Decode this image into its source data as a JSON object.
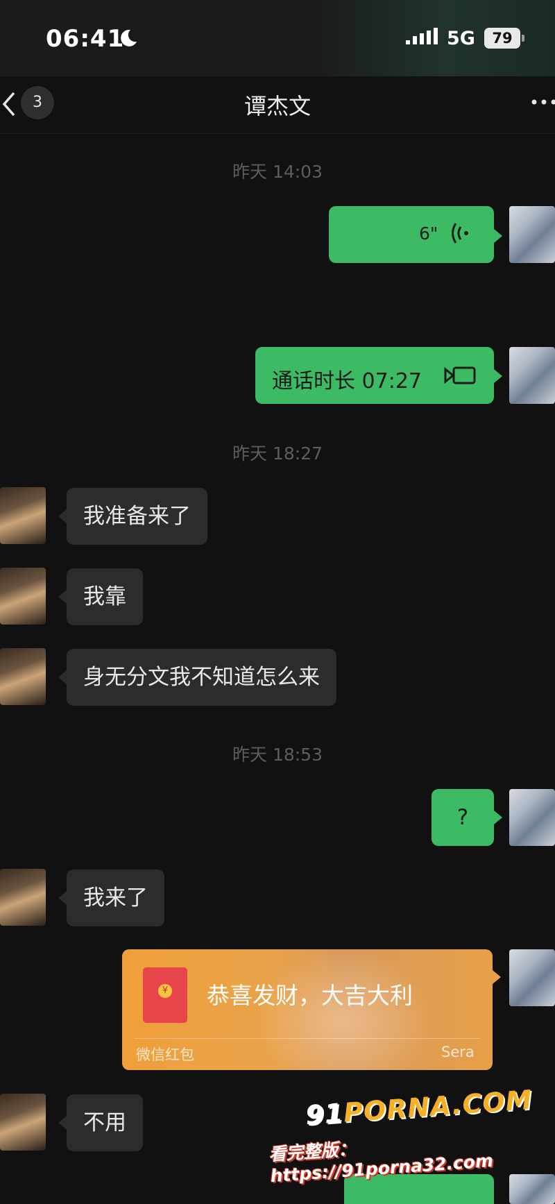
{
  "status_bar": {
    "time": "06:41",
    "moon_icon": "moon-icon",
    "signal_icon": "signal-icon",
    "network": "5G",
    "battery": "79"
  },
  "header": {
    "back_icon": "chevron-left-icon",
    "unread_count": "3",
    "title": "谭杰文",
    "more_icon": "more-icon"
  },
  "messages": {
    "ts1": "昨天 14:03",
    "voice_duration": "6\"",
    "call_label": "通话时长 07:27",
    "ts2": "昨天 18:27",
    "in1": "我准备来了",
    "in2": "我靠",
    "in3": "身无分文我不知道怎么来",
    "ts3": "昨天 18:53",
    "out_question": "?",
    "in4": "我来了",
    "redpacket": {
      "greeting": "恭喜发财，大吉大利",
      "type": "微信红包",
      "source": "Sera"
    },
    "in5": "不用"
  },
  "watermark": {
    "logo_num": "91",
    "logo_text": "PORNA.COM",
    "url": "看完整版：https://91porna32.com"
  },
  "colors": {
    "background": "#111111",
    "outgoing_bubble": "#3dbb64",
    "incoming_bubble": "#2c2c2c",
    "redpacket": "#f0a03a"
  }
}
